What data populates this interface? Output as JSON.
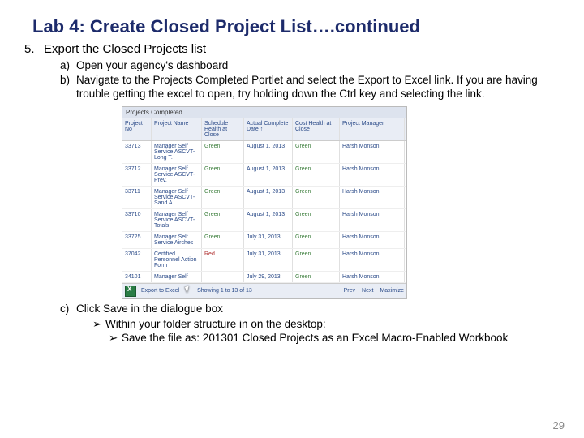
{
  "title": "Lab 4: Create Closed Project List….continued",
  "step": {
    "num": "5.",
    "text": "Export the Closed Projects list"
  },
  "subs": {
    "a": {
      "letter": "a)",
      "text": "Open your agency's dashboard"
    },
    "b": {
      "letter": "b)",
      "text": "Navigate to the Projects Completed Portlet and select the Export to Excel link.  If you are having trouble getting the excel to open, try holding down the Ctrl key and selecting the link."
    },
    "c": {
      "letter": "c)",
      "text": "Click Save in the dialogue box"
    }
  },
  "arrows": {
    "lvl1": "Within your folder structure in on the desktop:",
    "lvl2": "Save the file as: 201301 Closed Projects as an Excel Macro-Enabled Workbook"
  },
  "portlet": {
    "title": "Projects Completed",
    "headers": {
      "c1": "Project No",
      "c2": "Project Name",
      "c3": "Schedule Health at Close",
      "c4": "Actual Complete Date ↑",
      "c5": "Cost Health at Close",
      "c6": "Project Manager"
    },
    "rows": [
      {
        "c1": "33713",
        "c2": "Manager Self Service ASCVT- Long T.",
        "c3": "Green",
        "c4": "August 1, 2013",
        "c5": "Green",
        "c6": "Harsh Monson"
      },
      {
        "c1": "33712",
        "c2": "Manager Self Service ASCVT- Prev.",
        "c3": "Green",
        "c4": "August 1, 2013",
        "c5": "Green",
        "c6": "Harsh Monson"
      },
      {
        "c1": "33711",
        "c2": "Manager Self Service ASCVT- Sand A.",
        "c3": "Green",
        "c4": "August 1, 2013",
        "c5": "Green",
        "c6": "Harsh Monson"
      },
      {
        "c1": "33710",
        "c2": "Manager Self Service ASCVT- Totals",
        "c3": "Green",
        "c4": "August 1, 2013",
        "c5": "Green",
        "c6": "Harsh Monson"
      },
      {
        "c1": "33725",
        "c2": "Manager Self Service Airches",
        "c3": "Green",
        "c4": "July 31, 2013",
        "c5": "Green",
        "c6": "Harsh Monson"
      },
      {
        "c1": "37042",
        "c2": "Certified Personnel Action Form",
        "c3": "Red",
        "c4": "July 31, 2013",
        "c5": "Green",
        "c6": "Harsh Monson",
        "red": true
      },
      {
        "c1": "34101",
        "c2": "Manager Self",
        "c3": "",
        "c4": "July 29, 2013",
        "c5": "Green",
        "c6": "Harsh Monson"
      }
    ],
    "footer": {
      "export": "Export to Excel",
      "showing": "Showing 1 to 13 of 13",
      "prev": "Prev",
      "next": "Next",
      "max": "Maximize"
    }
  },
  "page_number": "29",
  "glyphs": {
    "arrow": "➢"
  }
}
